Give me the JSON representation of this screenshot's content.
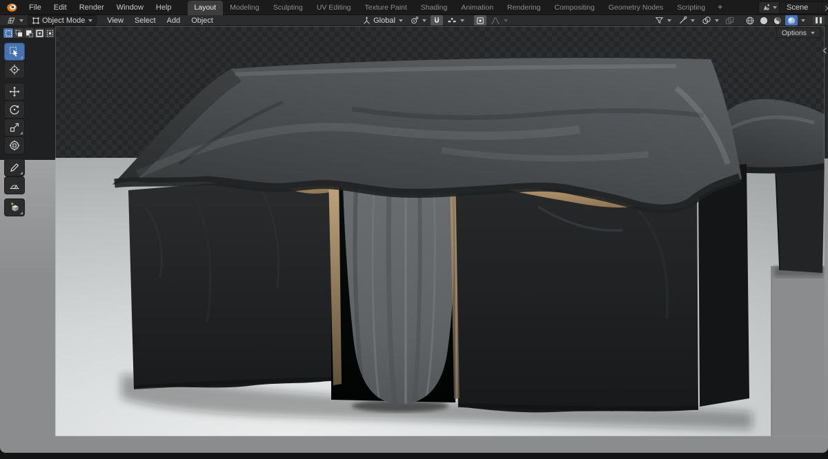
{
  "topbar": {
    "menus": [
      "File",
      "Edit",
      "Render",
      "Window",
      "Help"
    ],
    "workspaces": [
      "Layout",
      "Modeling",
      "Sculpting",
      "UV Editing",
      "Texture Paint",
      "Shading",
      "Animation",
      "Rendering",
      "Compositing",
      "Geometry Nodes",
      "Scripting"
    ],
    "active_workspace": "Layout",
    "add_workspace_label": "+",
    "scene_name": "Scene"
  },
  "viewport_header": {
    "mode": "Object Mode",
    "menus": [
      "View",
      "Select",
      "Add",
      "Object"
    ],
    "transform_orientation": "Global"
  },
  "viewport": {
    "options_label": "Options",
    "tools": [
      "select-box",
      "cursor",
      "move",
      "rotate",
      "scale",
      "transform",
      "annotate",
      "measure",
      "add-cube"
    ],
    "active_tool": "select-box",
    "select_modes": [
      "set",
      "extend",
      "subtract",
      "invert",
      "intersect"
    ],
    "active_select_mode": "set",
    "shading_modes": [
      "wireframe",
      "solid",
      "material-preview",
      "rendered"
    ],
    "active_shading_mode": "rendered",
    "snapping_enabled": "true",
    "proportional_editing_enabled": "true"
  },
  "colors": {
    "accent_blue": "#4772b3",
    "topbar_bg": "#1b1b1b",
    "header_bg": "#2c2c2c",
    "checker_dark": "#252627",
    "checker_light": "#2d2e2f",
    "floor_light": "#eceeee",
    "floor_far": "#a5a8a9",
    "passepartout_gray": "#8a8c8d",
    "wood_tan": "#c0a379",
    "cloth_wall": "#1e2021",
    "cloth_roof": "#4a4d4f",
    "curtain_gray": "#5c5f61"
  }
}
